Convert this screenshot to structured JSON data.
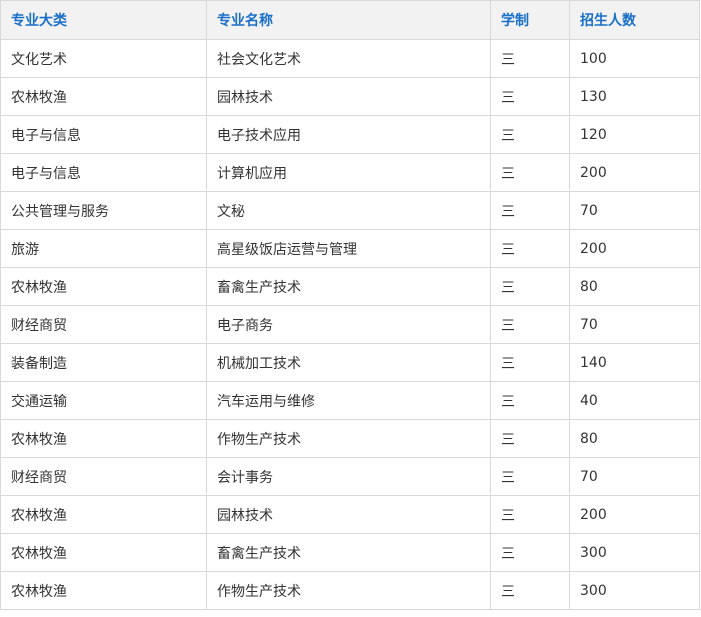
{
  "table": {
    "headers": [
      "专业大类",
      "专业名称",
      "学制",
      "招生人数"
    ],
    "rows": [
      [
        "文化艺术",
        "社会文化艺术",
        "三",
        "100"
      ],
      [
        "农林牧渔",
        "园林技术",
        "三",
        "130"
      ],
      [
        "电子与信息",
        "电子技术应用",
        "三",
        "120"
      ],
      [
        "电子与信息",
        "计算机应用",
        "三",
        "200"
      ],
      [
        "公共管理与服务",
        "文秘",
        "三",
        "70"
      ],
      [
        "旅游",
        "高星级饭店运营与管理",
        "三",
        "200"
      ],
      [
        "农林牧渔",
        "畜禽生产技术",
        "三",
        "80"
      ],
      [
        "财经商贸",
        "电子商务",
        "三",
        "70"
      ],
      [
        "装备制造",
        "机械加工技术",
        "三",
        "140"
      ],
      [
        "交通运输",
        "汽车运用与维修",
        "三",
        "40"
      ],
      [
        "农林牧渔",
        "作物生产技术",
        "三",
        "80"
      ],
      [
        "财经商贸",
        "会计事务",
        "三",
        "70"
      ],
      [
        "农林牧渔",
        "园林技术",
        "三",
        "200"
      ],
      [
        "农林牧渔",
        "畜禽生产技术",
        "三",
        "300"
      ],
      [
        "农林牧渔",
        "作物生产技术",
        "三",
        "300"
      ]
    ]
  },
  "colors": {
    "header_text": "#1a6fc9",
    "header_bg": "#f2f2f2",
    "border": "#d9d9d9",
    "body_text": "#333333"
  }
}
